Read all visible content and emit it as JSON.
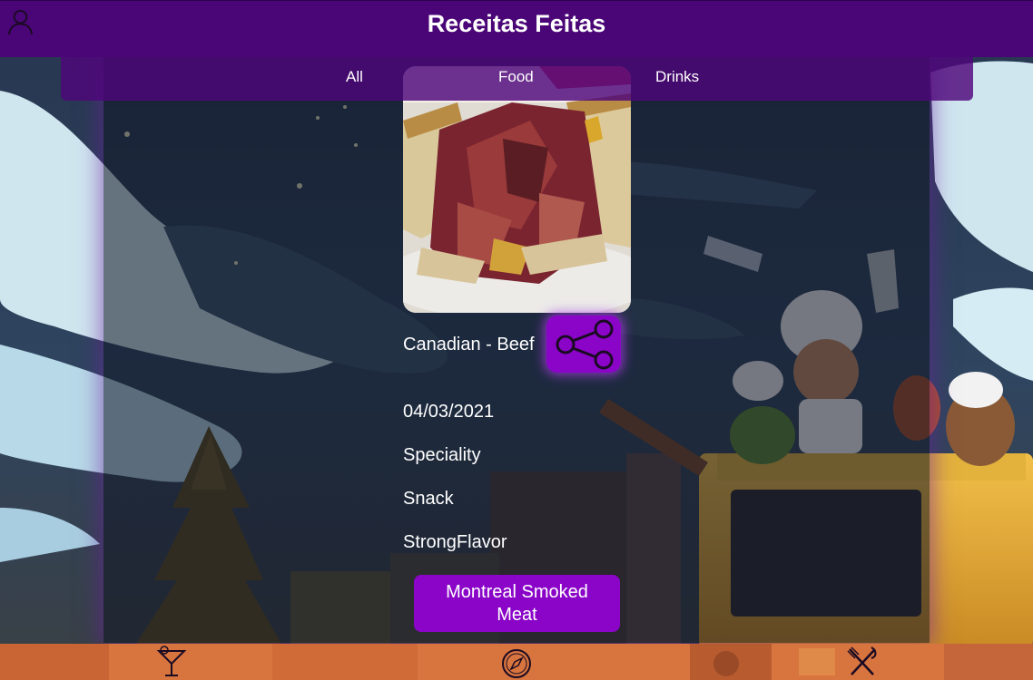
{
  "header": {
    "title": "Receitas Feitas",
    "profile_icon": "profile-icon"
  },
  "filters": {
    "all_label": "All",
    "food_label": "Food",
    "drinks_label": "Drinks"
  },
  "recipe": {
    "image_icon": "recipe-photo",
    "category": "Canadian - Beef",
    "date": "04/03/2021",
    "tags": [
      "Speciality",
      "Snack",
      "StrongFlavor"
    ],
    "name": "Montreal Smoked Meat",
    "share_icon": "share-icon"
  },
  "footer": {
    "drinks_icon": "cocktail-icon",
    "explore_icon": "compass-icon",
    "food_icon": "utensils-icon"
  },
  "colors": {
    "header": "#4a0576",
    "filter_bar": "#4e067a",
    "accent": "#8a05c8",
    "footer": "#d8743e"
  }
}
